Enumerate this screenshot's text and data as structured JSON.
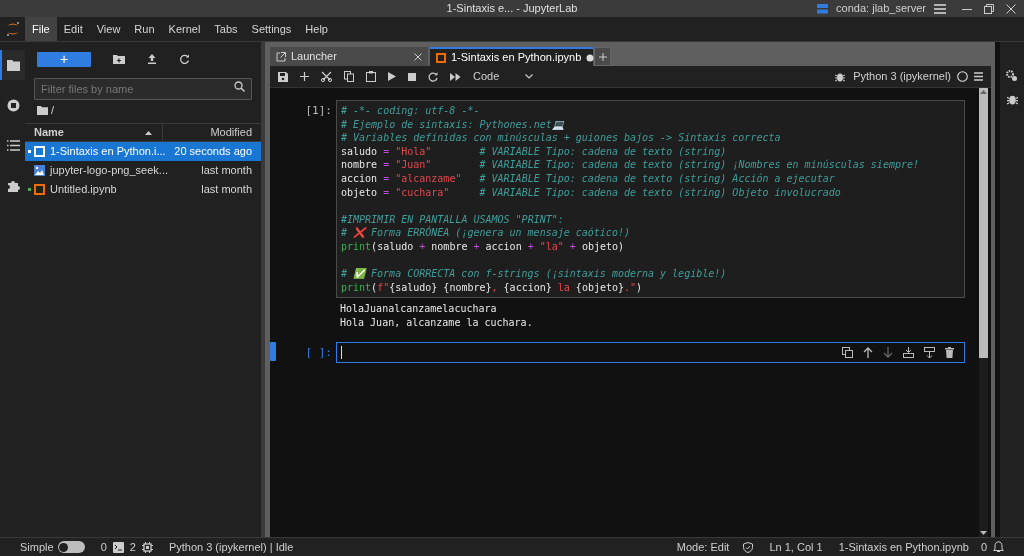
{
  "window": {
    "title": "1-Sintaxis e... - JupyterLab",
    "environment": "conda: jlab_server"
  },
  "menu": [
    {
      "label": "File",
      "selected": true
    },
    {
      "label": "Edit",
      "selected": false
    },
    {
      "label": "View",
      "selected": false
    },
    {
      "label": "Run",
      "selected": false
    },
    {
      "label": "Kernel",
      "selected": false
    },
    {
      "label": "Tabs",
      "selected": false
    },
    {
      "label": "Settings",
      "selected": false
    },
    {
      "label": "Help",
      "selected": false
    }
  ],
  "left_bar": [
    {
      "kind": "folder",
      "selected": true
    },
    {
      "kind": "stop",
      "selected": false
    },
    {
      "kind": "list",
      "selected": false
    },
    {
      "kind": "puzzle",
      "selected": false
    }
  ],
  "file_browser": {
    "new_button": "+",
    "filter": {
      "placeholder": "Filter files by name"
    },
    "path": "/",
    "columns": [
      "Name",
      "Modified"
    ],
    "files": [
      {
        "name": "1-Sintaxis en Python.i...",
        "modified": "20 seconds ago",
        "kind": "notebook",
        "running": true,
        "selected": true
      },
      {
        "name": "jupyter-logo-png_seek...",
        "modified": "last month",
        "kind": "image",
        "running": false,
        "selected": false
      },
      {
        "name": "Untitled.ipynb",
        "modified": "last month",
        "kind": "notebook",
        "running": true,
        "selected": false
      }
    ]
  },
  "tabs": [
    {
      "label": "Launcher",
      "kind": "launcher",
      "selected": false,
      "dirty": false
    },
    {
      "label": "1-Sintaxis en Python.ipynb",
      "kind": "notebook",
      "selected": true,
      "dirty": true
    }
  ],
  "toolbar": {
    "cell_type": "Code",
    "kernel": "Python 3 (ipykernel)"
  },
  "cells": [
    {
      "prompt": "[1]:",
      "active": false,
      "source_blocks": [
        [
          [
            {
              "kind": "comment",
              "text": "# -*- coding: utf-8 -*-"
            }
          ],
          [
            {
              "kind": "comment",
              "text": "# Ejemplo de sintaxis: Pythones.net💻"
            }
          ],
          [
            {
              "kind": "comment",
              "text": "# Variables definidas con minúsculas + guiones bajos -> Sintaxis correcta"
            }
          ],
          [
            {
              "kind": "name",
              "text": "saludo "
            },
            {
              "kind": "op",
              "text": "="
            },
            {
              "kind": "string",
              "text": " \"Hola\""
            },
            {
              "kind": "comment",
              "text": "        # VARIABLE Tipo: cadena de texto (string)"
            }
          ],
          [
            {
              "kind": "name",
              "text": "nombre "
            },
            {
              "kind": "op",
              "text": "="
            },
            {
              "kind": "string",
              "text": " \"Juan\""
            },
            {
              "kind": "comment",
              "text": "        # VARIABLE Tipo: cadena de texto (string) ¡Nombres en minúsculas siempre!"
            }
          ],
          [
            {
              "kind": "name",
              "text": "accion "
            },
            {
              "kind": "op",
              "text": "="
            },
            {
              "kind": "string",
              "text": " \"alcanzame\""
            },
            {
              "kind": "comment",
              "text": "   # VARIABLE Tipo: cadena de texto (string) Acción a ejecutar"
            }
          ],
          [
            {
              "kind": "name",
              "text": "objeto "
            },
            {
              "kind": "op",
              "text": "="
            },
            {
              "kind": "string",
              "text": " \"cuchara\""
            },
            {
              "kind": "comment",
              "text": "     # VARIABLE Tipo: cadena de texto (string) Objeto involucrado"
            }
          ]
        ],
        [
          [
            {
              "kind": "comment",
              "text": "#IMPRIMIR EN PANTALLA USAMOS \"PRINT\":"
            }
          ],
          [
            {
              "kind": "comment",
              "text": "# ❌ Forma ERRÓNEA (¡genera un mensaje caótico!)"
            }
          ],
          [
            {
              "kind": "builtin",
              "text": "print"
            },
            {
              "kind": "name",
              "text": "(saludo "
            },
            {
              "kind": "op",
              "text": "+"
            },
            {
              "kind": "name",
              "text": " nombre "
            },
            {
              "kind": "op",
              "text": "+"
            },
            {
              "kind": "name",
              "text": " accion "
            },
            {
              "kind": "op",
              "text": "+"
            },
            {
              "kind": "string",
              "text": " \"la\" "
            },
            {
              "kind": "op",
              "text": "+"
            },
            {
              "kind": "name",
              "text": " objeto)"
            }
          ]
        ],
        [
          [
            {
              "kind": "comment",
              "text": "# ✅ Forma CORRECTA con f-strings (¡sintaxis moderna y legible!)"
            }
          ],
          [
            {
              "kind": "builtin",
              "text": "print"
            },
            {
              "kind": "name",
              "text": "("
            },
            {
              "kind": "string",
              "text": "f\""
            },
            {
              "kind": "name",
              "text": "{saludo} {nombre}"
            },
            {
              "kind": "string",
              "text": ", "
            },
            {
              "kind": "name",
              "text": "{accion}"
            },
            {
              "kind": "string",
              "text": " la "
            },
            {
              "kind": "name",
              "text": "{objeto}"
            },
            {
              "kind": "string",
              "text": ".\""
            },
            {
              "kind": "name",
              "text": ")"
            }
          ]
        ]
      ],
      "outputs": [
        "HolaJuanalcanzamelacuchara",
        "Hola Juan, alcanzame la cuchara."
      ]
    },
    {
      "prompt": "[ ]:",
      "active": true
    }
  ],
  "status_bar": {
    "simple_mode": false,
    "simple_label": "Simple",
    "terminals": "0",
    "kernels": "2",
    "kernel_status": "Python 3 (ipykernel) | Idle",
    "mode": "Mode: Edit",
    "cursor": "Ln 1, Col 1",
    "file": "1-Sintaxis en Python.ipynb",
    "notifications": "0"
  }
}
